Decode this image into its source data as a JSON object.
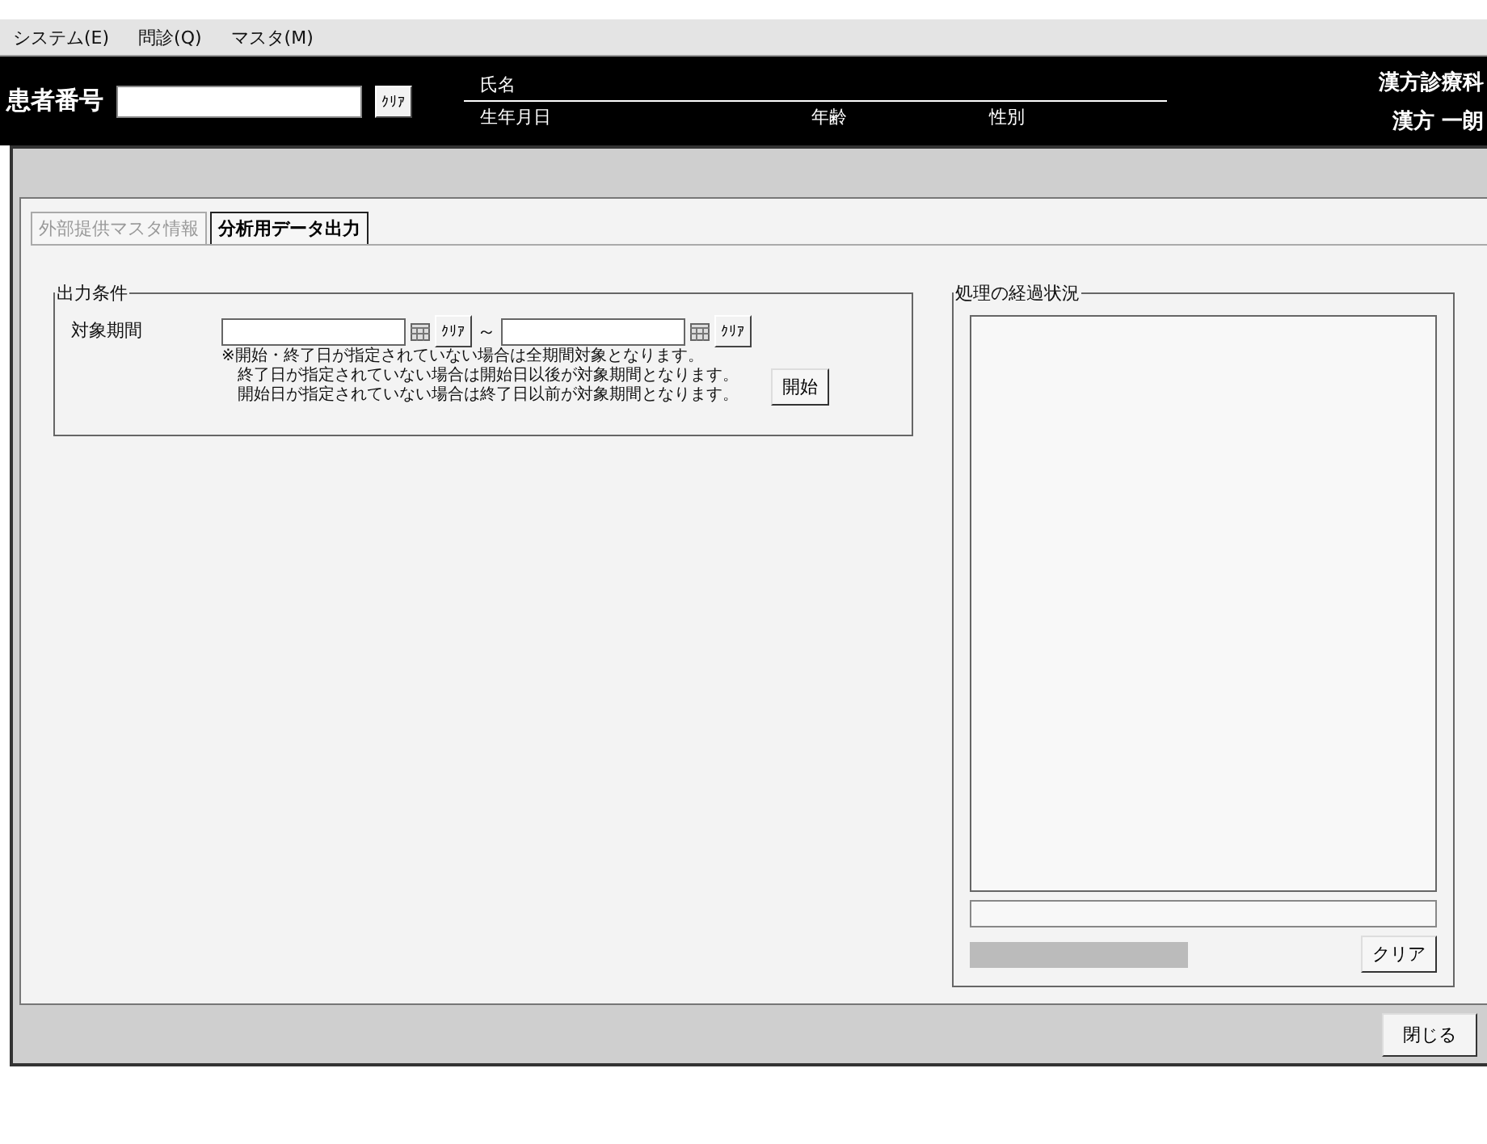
{
  "menu": [
    "システム(E)",
    "問診(Q)",
    "マスタ(M)"
  ],
  "header": {
    "patient_number_label": "患者番号",
    "clear_button": "ｸﾘｱ",
    "name_label": "氏名",
    "birthdate_label": "生年月日",
    "age_label": "年齢",
    "sex_label": "性別",
    "department": "漢方診療科",
    "user": "漢方 一朗"
  },
  "tabs": [
    {
      "label": "外部提供マスタ情報",
      "selected": false
    },
    {
      "label": "分析用データ出力",
      "selected": true
    }
  ],
  "output_conditions": {
    "title": "出力条件",
    "period_label": "対象期間",
    "start_clear_button": "ｸﾘｱ",
    "separator": "～",
    "end_clear_button": "ｸﾘｱ",
    "notes": [
      "※開始・終了日が指定されていない場合は全期間対象となります。",
      "終了日が指定されていない場合は開始日以後が対象期間となります。",
      "開始日が指定されていない場合は終了日以前が対象期間となります。"
    ],
    "start_button": "開始"
  },
  "progress": {
    "title": "処理の経過状況",
    "clear_button": "クリア"
  },
  "close_button": "閉じる"
}
